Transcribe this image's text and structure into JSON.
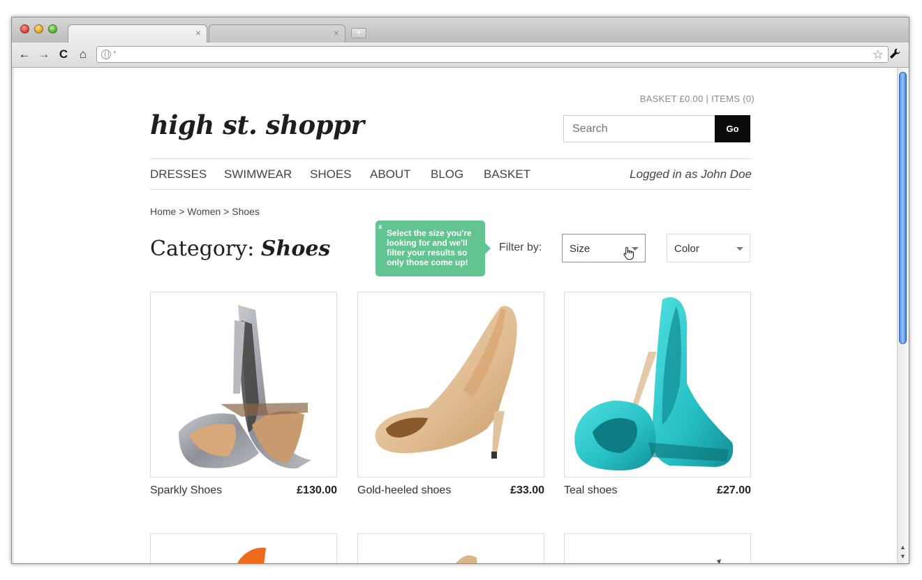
{
  "browser": {
    "tab_close_glyph": "×",
    "new_tab_glyph": "+",
    "back_icon": "←",
    "forward_icon": "→",
    "reload_icon": "C",
    "home_icon": "⌂",
    "url_value": "'",
    "bookmark_icon": "☆",
    "wrench_icon": "🔧"
  },
  "header": {
    "basket_summary": "BASKET £0.00 | ITEMS (0)",
    "logo": "high st. shoppr",
    "search_placeholder": "Search",
    "search_button": "Go"
  },
  "nav": {
    "items": [
      "DRESSES",
      "SWIMWEAR",
      "SHOES",
      "ABOUT",
      "BLOG",
      "BASKET"
    ],
    "logged_in": "Logged in as John Doe"
  },
  "breadcrumb": "Home > Women > Shoes",
  "category": {
    "prefix": "Category: ",
    "name": "Shoes"
  },
  "tooltip": {
    "close": "x",
    "text": "Select the size you're looking for and we'll filter your results so only those come up!"
  },
  "filter": {
    "label": "Filter by:",
    "size": "Size",
    "color": "Color"
  },
  "products": [
    {
      "name": "Sparkly Shoes",
      "price": "£130.00"
    },
    {
      "name": "Gold-heeled shoes",
      "price": "£33.00"
    },
    {
      "name": "Teal shoes",
      "price": "£27.00"
    }
  ],
  "colors": {
    "tooltip": "#62c490",
    "search_button": "#0b0b0b",
    "shoe_silver": "#9a9ca3",
    "shoe_gold": "#e6c49e",
    "shoe_teal": "#2fc6c9",
    "shoe_orange": "#f06a1e"
  }
}
